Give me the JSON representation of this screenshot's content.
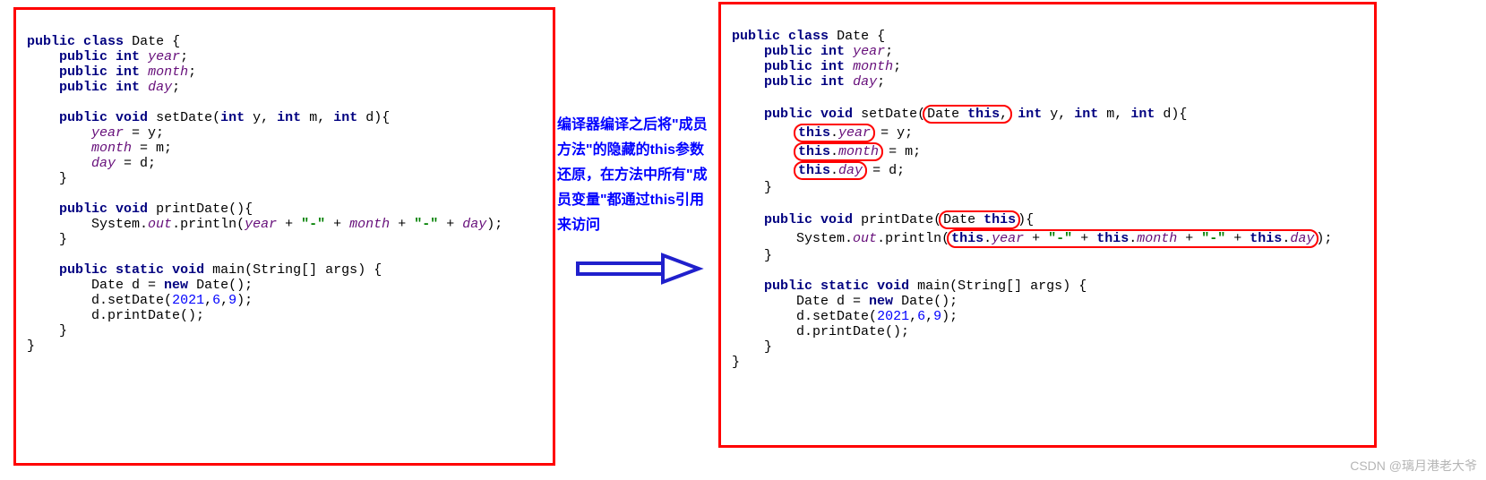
{
  "center_text": "编译器编译之后将\"成员方法\"的隐藏的this参数还原，在方法中所有\"成员变量\"都通过this引用来访问",
  "watermark": "CSDN @璃月港老大爷",
  "code": {
    "kw_public": "public",
    "kw_class": "class",
    "kw_int": "int",
    "kw_void": "void",
    "kw_static": "static",
    "kw_new": "new",
    "kw_this": "this",
    "cls_Date": "Date",
    "cls_String": "String",
    "cls_System": "System",
    "fld_out": "out",
    "fld_year": "year",
    "fld_month": "month",
    "fld_day": "day",
    "var_y": "y",
    "var_m": "m",
    "var_d": "d",
    "var_args": "args",
    "mtd_setDate": "setDate",
    "mtd_printDate": "printDate",
    "mtd_println": "println",
    "mtd_main": "main",
    "str_dash": "\"-\"",
    "num_2021": "2021",
    "num_6": "6",
    "num_9": "9"
  }
}
